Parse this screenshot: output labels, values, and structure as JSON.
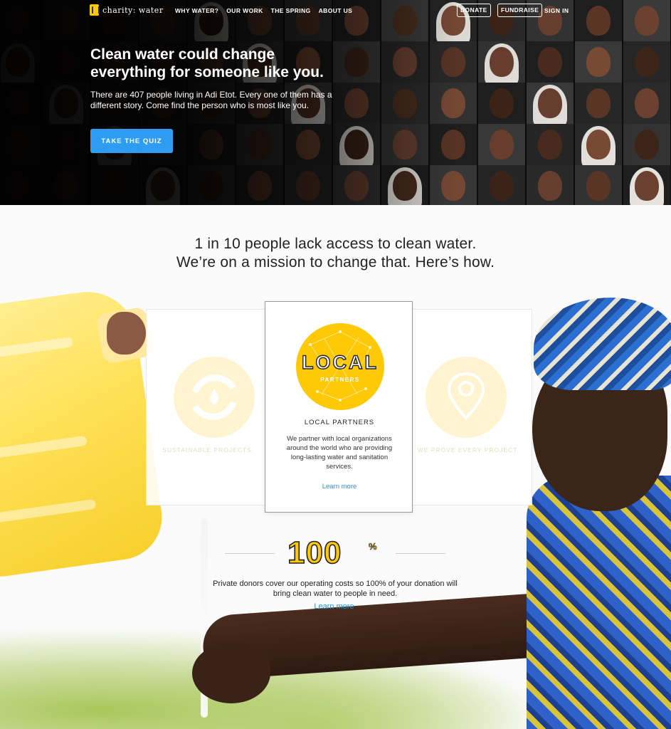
{
  "nav": {
    "logo_text": "charity: water",
    "links": [
      "WHY WATER?",
      "OUR WORK",
      "THE SPRING",
      "ABOUT US"
    ],
    "donate_label": "DONATE",
    "fundraise_label": "FUNDRAISE",
    "signin_label": "SIGN IN"
  },
  "hero": {
    "title": "Clean water could change everything for someone like you.",
    "text": "There are 407 people living in Adi Etot. Every one of them has a different story. Come find the person who is most like you.",
    "button_label": "TAKE THE QUIZ"
  },
  "mission": {
    "line1": "1 in 10 people lack access to clean water.",
    "line2": "We’re on a mission to change that. Here’s how."
  },
  "cards": {
    "left_label": "SUSTAINABLE PROJECTS",
    "center": {
      "badge_word": "LOCAL",
      "badge_sub": "PARTNERS",
      "title": "LOCAL PARTNERS",
      "text": "We partner with local organizations around the world who are providing long-lasting water and sanitation services.",
      "link": "Learn more"
    },
    "right_label": "WE PROVE EVERY PROJECT"
  },
  "hundred": {
    "number": "100",
    "symbol": "%",
    "text": "Private donors cover our operating costs so 100% of your donation will bring clean water to people in need.",
    "link": "Learn more",
    "link_suffix": "."
  },
  "colors": {
    "accent_yellow": "#ffc907",
    "button_blue": "#2e9df1",
    "link_blue": "#2e8fd1"
  }
}
